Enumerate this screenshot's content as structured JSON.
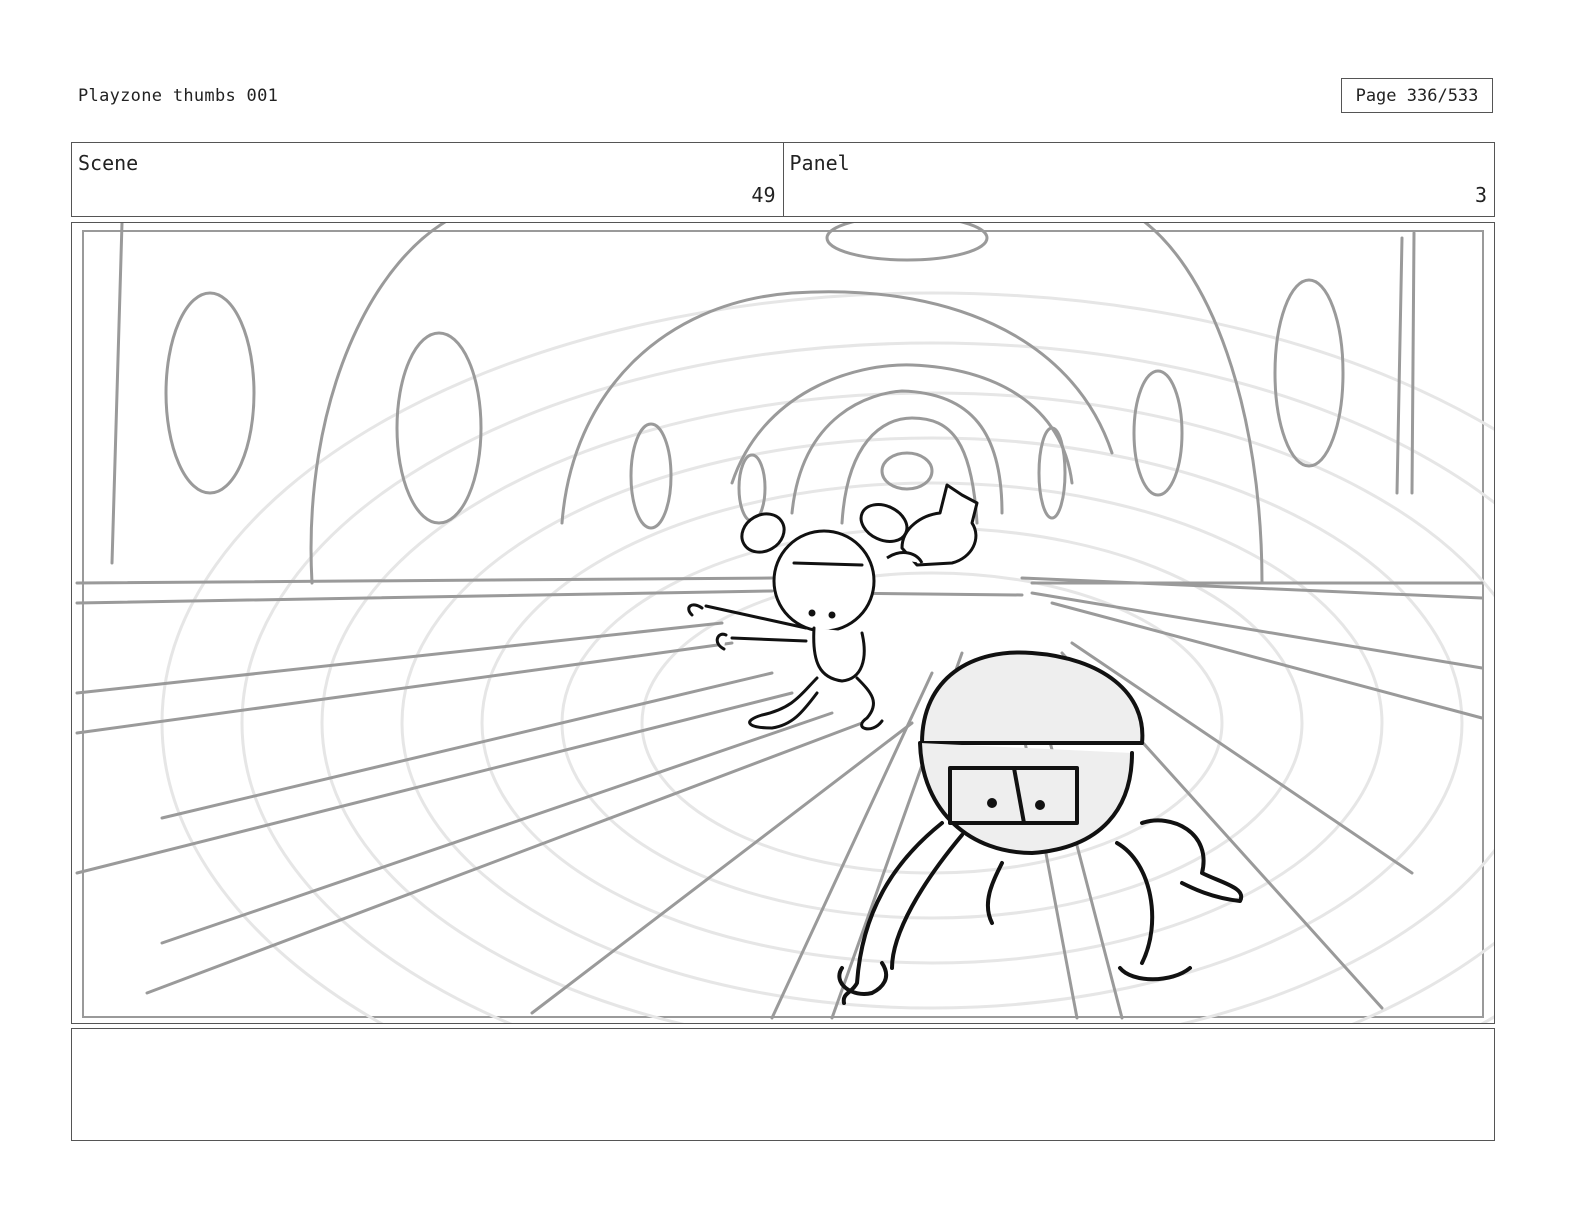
{
  "document": {
    "title": "Playzone thumbs 001",
    "page_label": "Page 336/533"
  },
  "header": {
    "scene_label": "Scene",
    "scene_value": "49",
    "panel_label": "Panel",
    "panel_value": "3"
  },
  "notes": {
    "text": ""
  },
  "colors": {
    "background_lines": "#9a9a9a",
    "floor_arcs": "#e6e6e6",
    "ink": "#111111",
    "character_fill": "#eeeeee"
  }
}
